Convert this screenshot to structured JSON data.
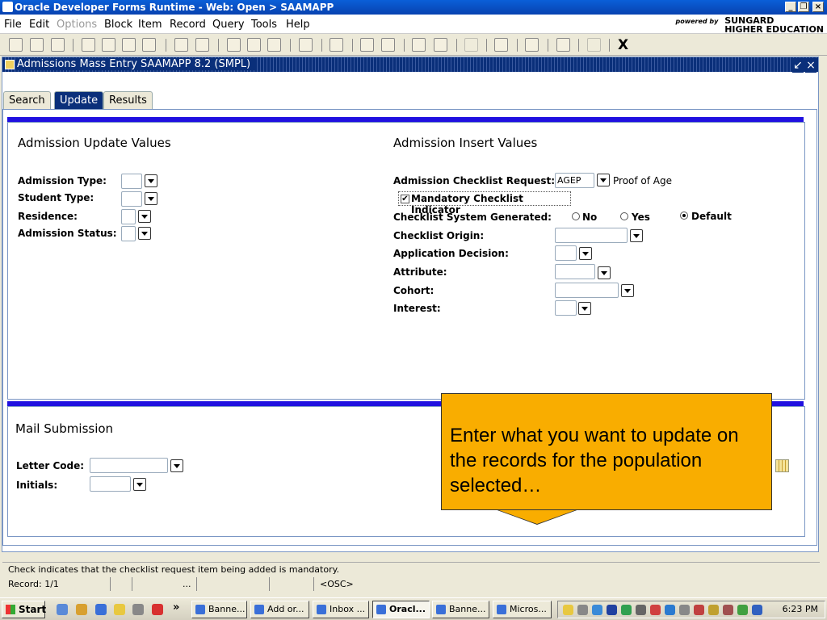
{
  "window": {
    "title": "Oracle Developer Forms Runtime - Web:  Open > SAAMAPP"
  },
  "menu": [
    "File",
    "Edit",
    "Options",
    "Block",
    "Item",
    "Record",
    "Query",
    "Tools",
    "Help"
  ],
  "brand": {
    "powered_by": "powered by",
    "name_line1": "SUNGARD",
    "name_line2": "HIGHER EDUCATION"
  },
  "toolbar": {
    "exit_label": "X"
  },
  "form": {
    "title": "Admissions Mass Entry  SAAMAPP  8.2  (SMPL)"
  },
  "tabs": [
    "Search",
    "Update",
    "Results"
  ],
  "update": {
    "heading": "Admission Update Values",
    "labels": {
      "admission_type": "Admission Type:",
      "student_type": "Student Type:",
      "residence": "Residence:",
      "admission_status": "Admission Status:"
    }
  },
  "insert": {
    "heading": "Admission Insert Values",
    "checklist_request_label": "Admission Checklist Request:",
    "checklist_request_value": "AGEP",
    "checklist_request_desc": "Proof of Age",
    "mandatory_label": "Mandatory Checklist Indicator",
    "system_generated_label": "Checklist System Generated:",
    "radio": {
      "no": "No",
      "yes": "Yes",
      "default": "Default"
    },
    "origin_label": "Checklist Origin:",
    "decision_label": "Application Decision:",
    "attribute_label": "Attribute:",
    "cohort_label": "Cohort:",
    "interest_label": "Interest:"
  },
  "mail": {
    "heading": "Mail Submission",
    "letter_code_label": "Letter Code:",
    "initials_label": "Initials:"
  },
  "callout": {
    "text": "Enter what you want to update on the records for the population selected…"
  },
  "status": {
    "hint": "Check indicates that the checklist request item being added is mandatory.",
    "record": "Record: 1/1",
    "ellipsis": "...",
    "osc": "<OSC>"
  },
  "taskbar": {
    "start": "Start",
    "chevron": "»",
    "tasks": [
      "Banne...",
      "Add or...",
      "Inbox ...",
      "Oracl...",
      "Banne...",
      "Micros..."
    ],
    "clock": "6:23 PM"
  },
  "colors": {
    "accent_bar": "#2010e0",
    "callout": "#f9ad00",
    "form_title": "#0a2f7a"
  }
}
